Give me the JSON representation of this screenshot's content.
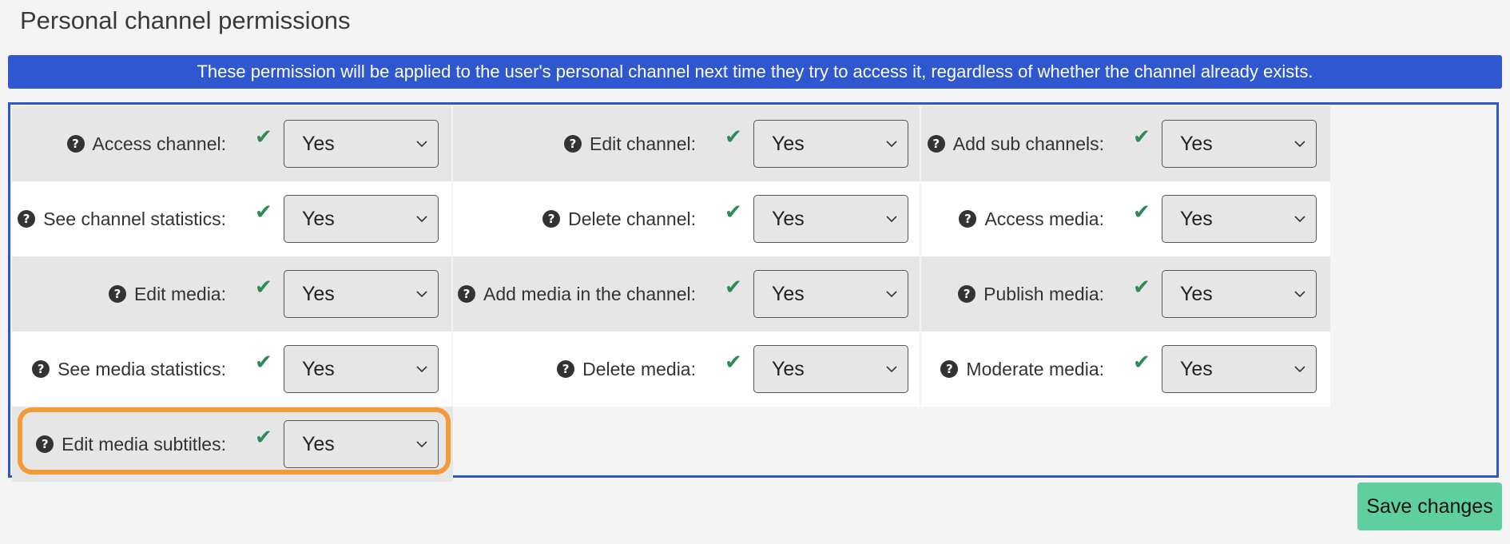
{
  "page": {
    "title": "Personal channel permissions",
    "banner": "These permission will be applied to the user's personal channel next time they try to access it, regardless of whether the channel already exists."
  },
  "icons": {
    "help": "question-circle-icon",
    "check": "checkmark-icon",
    "dropdown": "chevron-down-icon"
  },
  "colors": {
    "banner": "#2f57cf",
    "check": "#2e8b57",
    "highlight": "#f29b38",
    "save": "#5fcfa0"
  },
  "permissions": [
    [
      {
        "label": "Access channel:",
        "value": "Yes"
      },
      {
        "label": "Edit channel:",
        "value": "Yes"
      },
      {
        "label": "Add sub channels:",
        "value": "Yes"
      }
    ],
    [
      {
        "label": "See channel statistics:",
        "value": "Yes"
      },
      {
        "label": "Delete channel:",
        "value": "Yes"
      },
      {
        "label": "Access media:",
        "value": "Yes"
      }
    ],
    [
      {
        "label": "Edit media:",
        "value": "Yes"
      },
      {
        "label": "Add media in the channel:",
        "value": "Yes"
      },
      {
        "label": "Publish media:",
        "value": "Yes"
      }
    ],
    [
      {
        "label": "See media statistics:",
        "value": "Yes"
      },
      {
        "label": "Delete media:",
        "value": "Yes"
      },
      {
        "label": "Moderate media:",
        "value": "Yes"
      }
    ],
    [
      {
        "label": "Edit media subtitles:",
        "value": "Yes"
      }
    ]
  ],
  "actions": {
    "save": "Save changes"
  }
}
